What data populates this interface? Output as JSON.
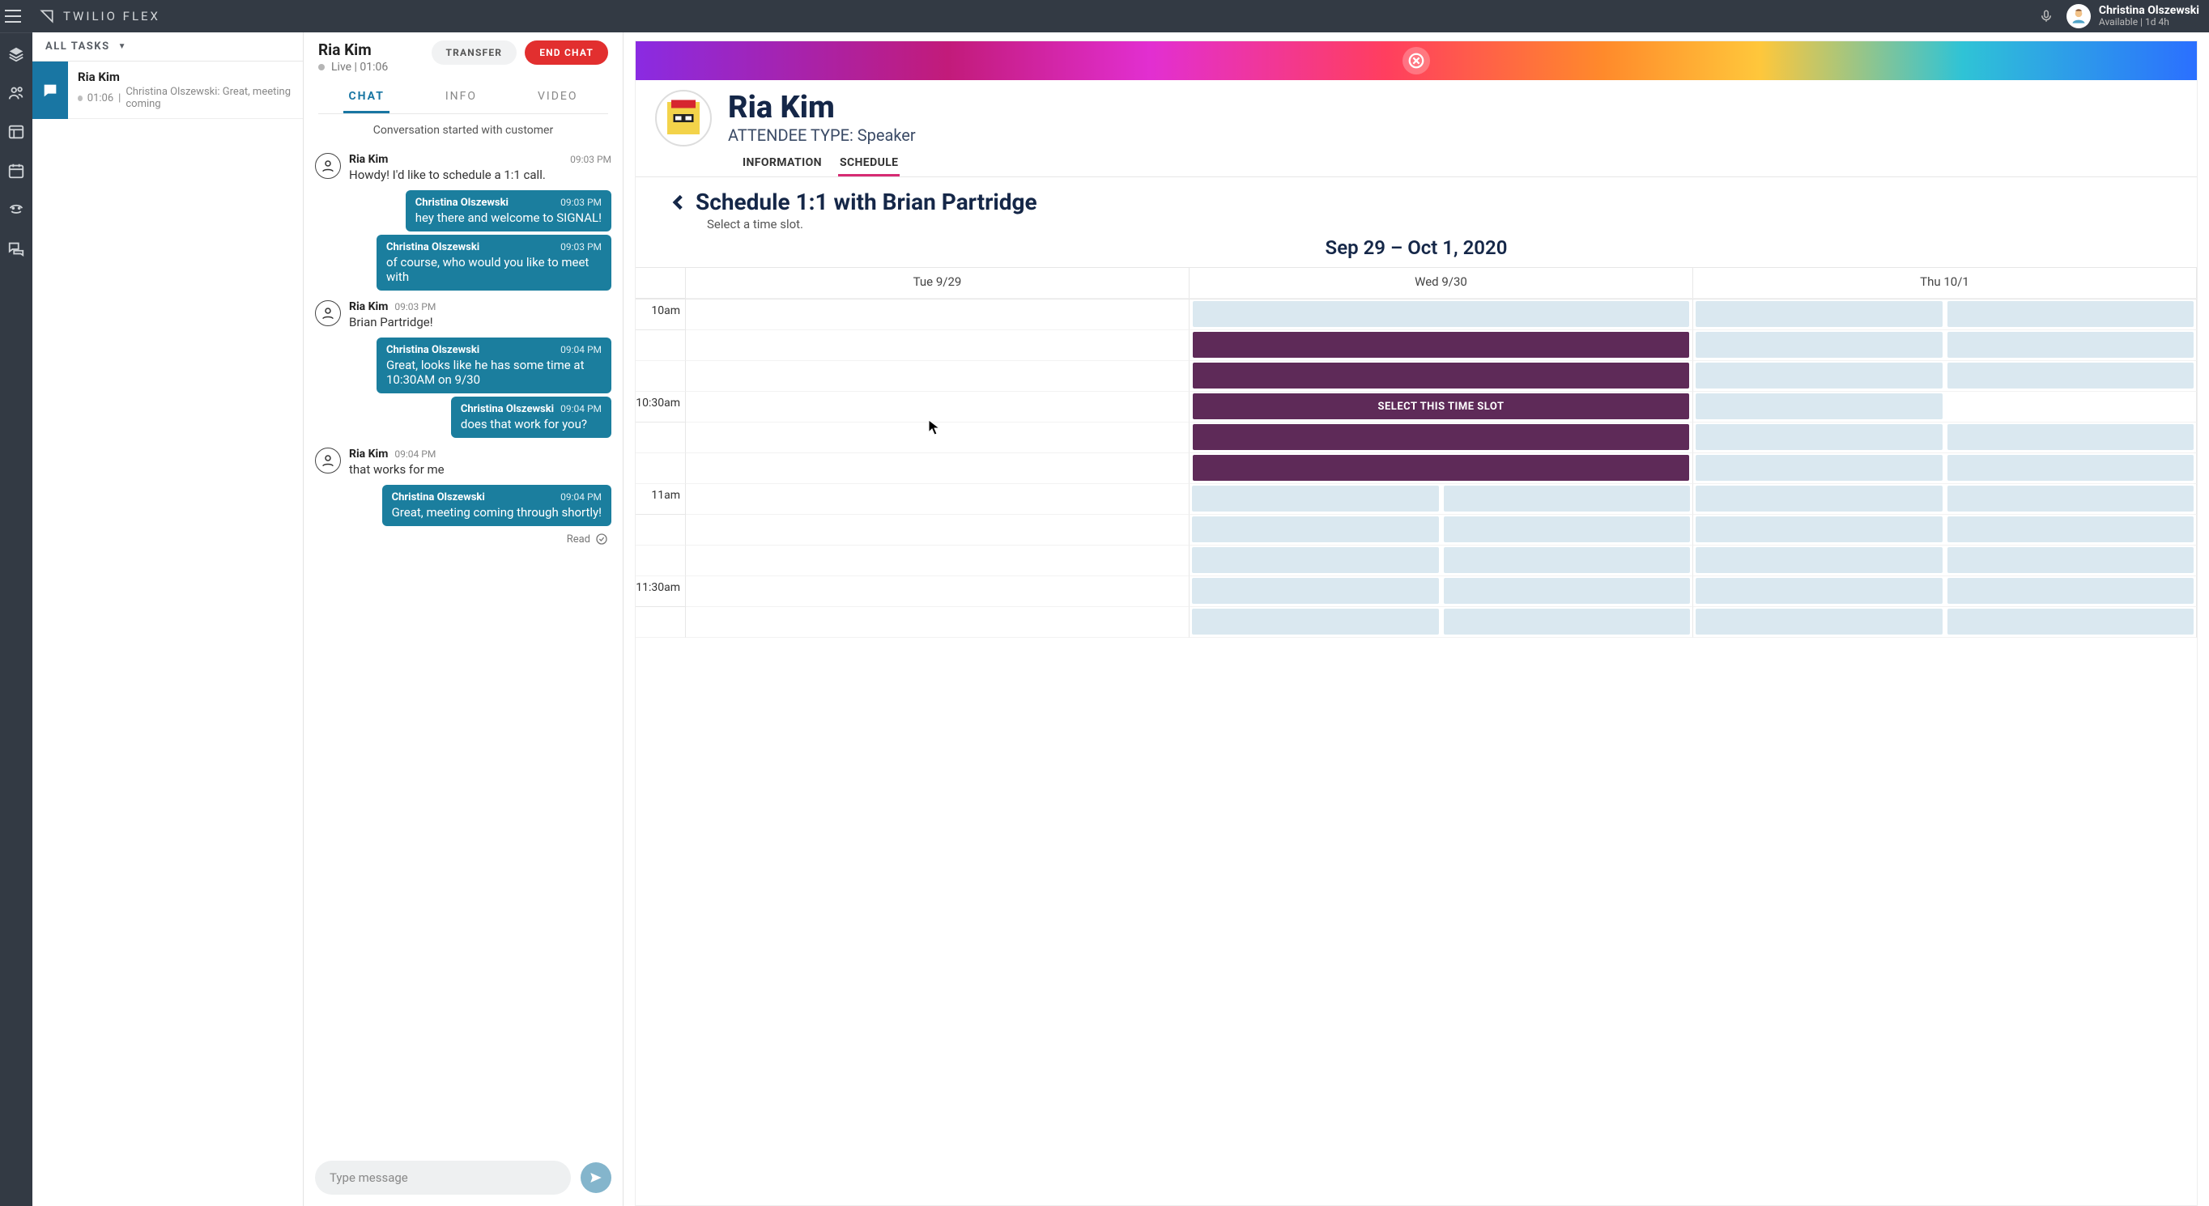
{
  "brand": "TWILIO FLEX",
  "topbar": {
    "user_name": "Christina Olszewski",
    "user_status": "Available | 1d 4h"
  },
  "tasklist": {
    "header_label": "ALL TASKS",
    "tasks": [
      {
        "title": "Ria Kim",
        "time": "01:06",
        "preview": "Christina Olszewski: Great, meeting coming"
      }
    ]
  },
  "convo": {
    "title": "Ria Kim",
    "status": "Live | 01:06",
    "transfer_label": "TRANSFER",
    "end_label": "END CHAT",
    "tabs": {
      "chat": "CHAT",
      "info": "INFO",
      "video": "VIDEO"
    },
    "started_text": "Conversation started with customer",
    "messages": [
      {
        "kind": "incoming",
        "sender": "Ria Kim",
        "time": "09:03 PM",
        "text": "Howdy! I'd like to schedule a 1:1 call."
      },
      {
        "kind": "outgoing",
        "sender": "Christina Olszewski",
        "time": "09:03 PM",
        "text": "hey there and welcome to SIGNAL!"
      },
      {
        "kind": "outgoing",
        "sender": "Christina Olszewski",
        "time": "09:03 PM",
        "text": "of course, who would you like to meet with"
      },
      {
        "kind": "incoming",
        "sender": "Ria Kim",
        "time": "09:03 PM",
        "text": "Brian Partridge!"
      },
      {
        "kind": "outgoing",
        "sender": "Christina Olszewski",
        "time": "09:04 PM",
        "text": "Great, looks like he has some time at 10:30AM on 9/30"
      },
      {
        "kind": "outgoing",
        "sender": "Christina Olszewski",
        "time": "09:04 PM",
        "text": "does that work for you?"
      },
      {
        "kind": "incoming",
        "sender": "Ria Kim",
        "time": "09:04 PM",
        "text": "that works for me"
      },
      {
        "kind": "outgoing",
        "sender": "Christina Olszewski",
        "time": "09:04 PM",
        "text": "Great, meeting coming through shortly!"
      }
    ],
    "read_label": "Read",
    "compose_placeholder": "Type message"
  },
  "crm": {
    "name": "Ria Kim",
    "attendee_type": "ATTENDEE TYPE: Speaker",
    "tabs": {
      "information": "INFORMATION",
      "schedule": "SCHEDULE"
    },
    "schedule": {
      "title": "Schedule 1:1 with Brian Partridge",
      "subtitle": "Select a time slot.",
      "date_range": "Sep 29 – Oct 1, 2020",
      "day_headers": [
        "Tue 9/29",
        "Wed 9/30",
        "Thu 10/1"
      ],
      "time_labels": [
        "10am",
        "",
        "",
        "10:30am",
        "",
        "",
        "11am",
        "",
        "",
        "11:30am",
        ""
      ],
      "select_label": "SELECT THIS TIME SLOT"
    }
  }
}
